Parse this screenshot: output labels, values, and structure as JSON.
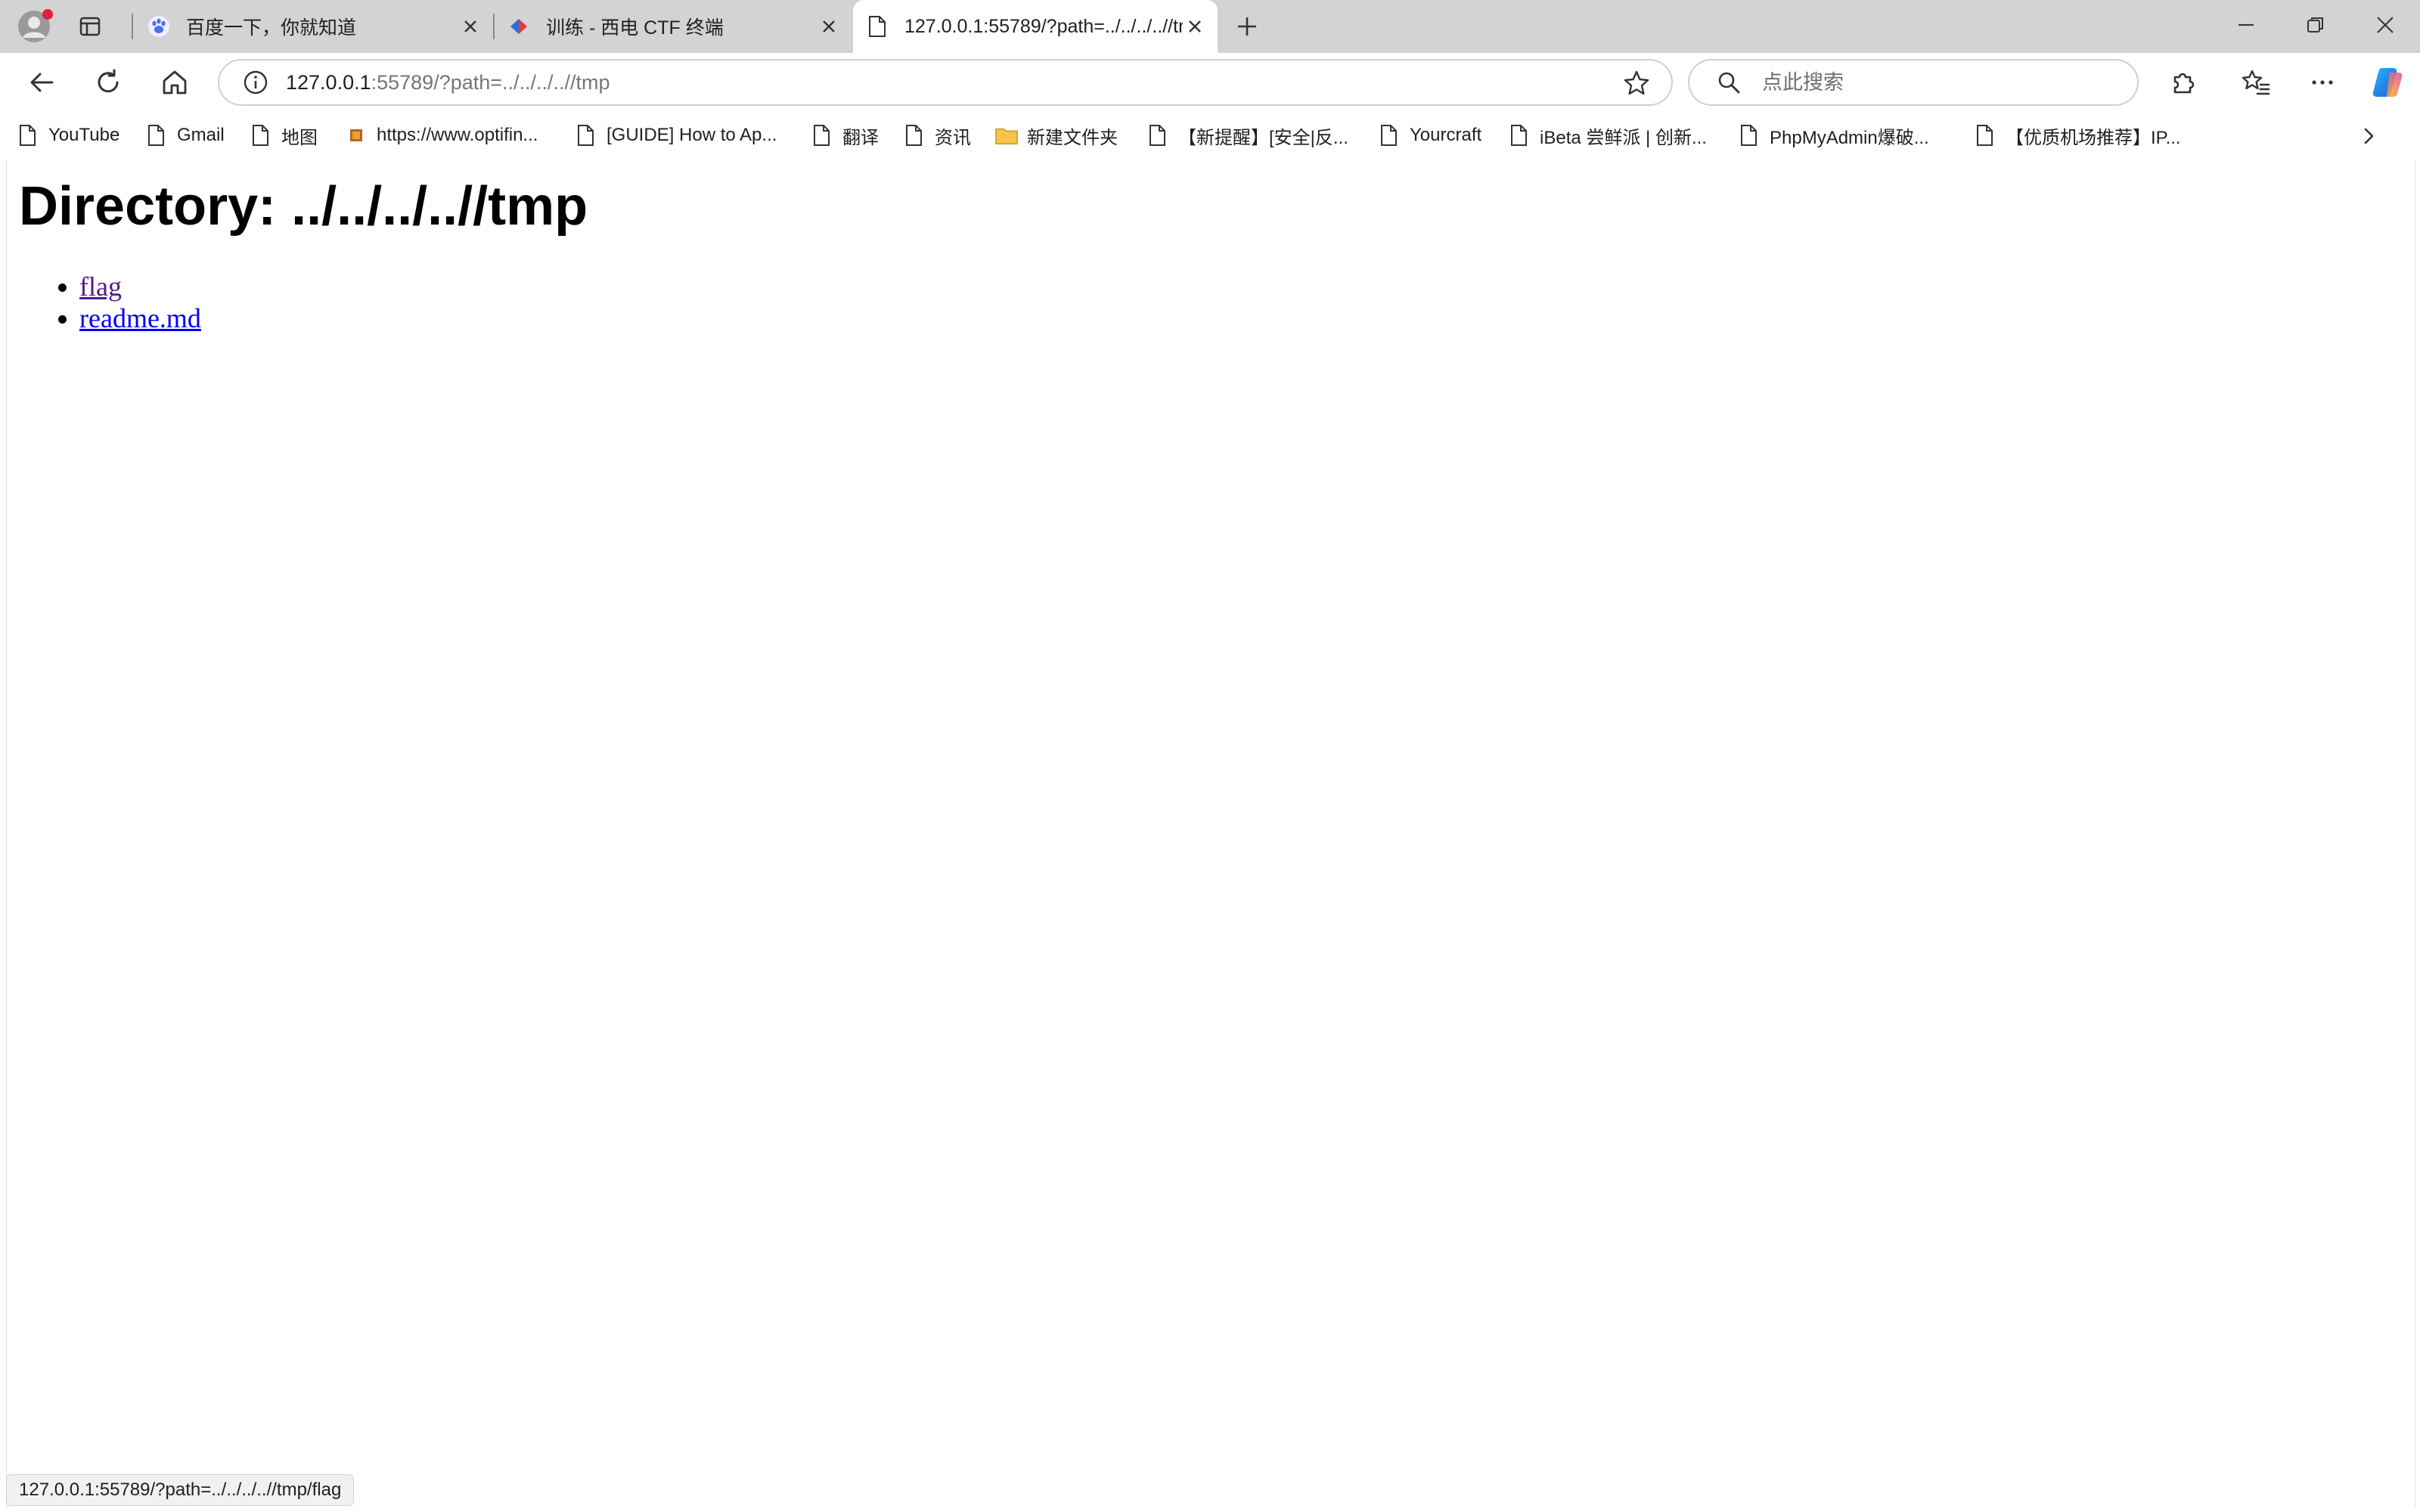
{
  "browser": {
    "tabs": [
      {
        "title": "百度一下，你就知道",
        "favicon": "baidu-paw-icon",
        "active": false
      },
      {
        "title": "训练 - 西电 CTF 终端",
        "favicon": "xidian-ctf-icon",
        "active": false
      },
      {
        "title": "127.0.0.1:55789/?path=../../../..//tm",
        "favicon": "page-icon",
        "active": true
      }
    ],
    "address": {
      "host": "127.0.0.1",
      "rest": ":55789/?path=../../../..//tmp"
    },
    "search": {
      "placeholder": "点此搜索"
    },
    "bookmarks": [
      {
        "label": "YouTube",
        "icon": "page-icon"
      },
      {
        "label": "Gmail",
        "icon": "page-icon"
      },
      {
        "label": "地图",
        "icon": "page-icon"
      },
      {
        "label": "https://www.optifin...",
        "icon": "optifine-icon"
      },
      {
        "label": "[GUIDE] How to Ap...",
        "icon": "page-icon"
      },
      {
        "label": "翻译",
        "icon": "page-icon"
      },
      {
        "label": "资讯",
        "icon": "page-icon"
      },
      {
        "label": "新建文件夹",
        "icon": "folder-icon"
      },
      {
        "label": "【新提醒】[安全|反...",
        "icon": "page-icon"
      },
      {
        "label": "Yourcraft",
        "icon": "page-icon"
      },
      {
        "label": "iBeta 尝鲜派 | 创新...",
        "icon": "page-icon"
      },
      {
        "label": "PhpMyAdmin爆破...",
        "icon": "page-icon"
      },
      {
        "label": "【优质机场推荐】IP...",
        "icon": "page-icon"
      }
    ],
    "status_url": "127.0.0.1:55789/?path=../../../..//tmp/flag"
  },
  "page": {
    "heading": "Directory: ../../../..//tmp",
    "entries": [
      {
        "name": "flag",
        "visited": true
      },
      {
        "name": "readme.md",
        "visited": false
      }
    ]
  },
  "colors": {
    "tabstrip": "#d3d3d3",
    "link": "#0000ee",
    "visited_link": "#551a8b",
    "profile_dot": "#e0203a"
  }
}
